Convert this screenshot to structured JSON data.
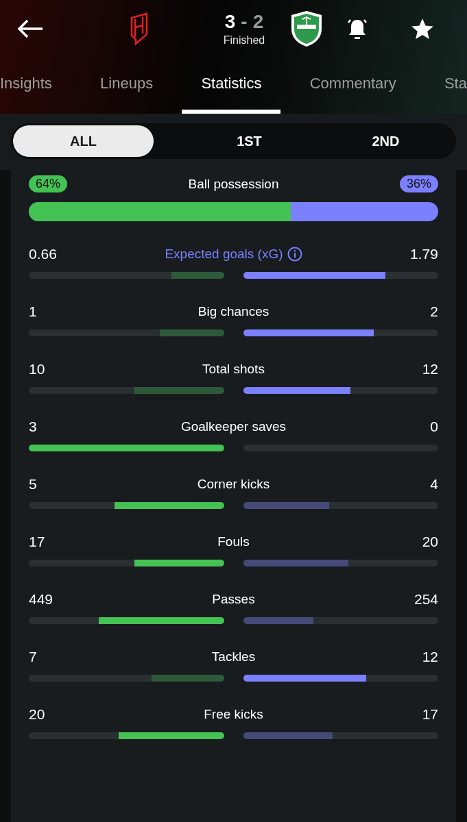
{
  "header": {
    "score_home": "3",
    "score_separator": "-",
    "score_away": "2",
    "status": "Finished"
  },
  "tabs": [
    {
      "label": "Insights",
      "selected": false
    },
    {
      "label": "Lineups",
      "selected": false
    },
    {
      "label": "Statistics",
      "selected": true
    },
    {
      "label": "Commentary",
      "selected": false
    },
    {
      "label": "Sta",
      "selected": false
    }
  ],
  "periods": [
    {
      "label": "ALL",
      "selected": true
    },
    {
      "label": "1ST",
      "selected": false
    },
    {
      "label": "2ND",
      "selected": false
    }
  ],
  "possession": {
    "home": "64%",
    "label": "Ball possession",
    "away": "36%",
    "level": 0.64
  },
  "stats": [
    {
      "kind": "info",
      "label": "Expected goals (xG)",
      "home": {
        "value": "0.66",
        "level": 0.27,
        "highlighted": false
      },
      "away": {
        "value": "1.79",
        "level": 0.73,
        "highlighted": true
      }
    },
    {
      "kind": "plain",
      "label": "Big chances",
      "home": {
        "value": "1",
        "level": 0.33,
        "highlighted": false
      },
      "away": {
        "value": "2",
        "level": 0.67,
        "highlighted": true
      }
    },
    {
      "kind": "plain",
      "label": "Total shots",
      "home": {
        "value": "10",
        "level": 0.46,
        "highlighted": false
      },
      "away": {
        "value": "12",
        "level": 0.55,
        "highlighted": true
      }
    },
    {
      "kind": "plain",
      "label": "Goalkeeper saves",
      "home": {
        "value": "3",
        "level": 1,
        "highlighted": true
      },
      "away": {
        "value": "0",
        "level": 0
      }
    },
    {
      "kind": "plain",
      "label": "Corner kicks",
      "home": {
        "value": "5",
        "level": 0.56,
        "highlighted": true
      },
      "away": {
        "value": "4",
        "level": 0.44,
        "highlighted": false
      }
    },
    {
      "kind": "plain",
      "label": "Fouls",
      "home": {
        "value": "17",
        "level": 0.46,
        "highlighted": true
      },
      "away": {
        "value": "20",
        "level": 0.54,
        "highlighted": false
      }
    },
    {
      "kind": "plain",
      "label": "Passes",
      "home": {
        "value": "449",
        "level": 0.64,
        "highlighted": true
      },
      "away": {
        "value": "254",
        "level": 0.36,
        "highlighted": false
      }
    },
    {
      "kind": "plain",
      "label": "Tackles",
      "home": {
        "value": "7",
        "level": 0.37,
        "highlighted": false
      },
      "away": {
        "value": "12",
        "level": 0.63,
        "highlighted": true
      }
    },
    {
      "kind": "plain",
      "label": "Free kicks",
      "home": {
        "value": "20",
        "level": 0.54,
        "highlighted": true
      },
      "away": {
        "value": "17",
        "level": 0.46,
        "highlighted": false
      }
    }
  ]
}
